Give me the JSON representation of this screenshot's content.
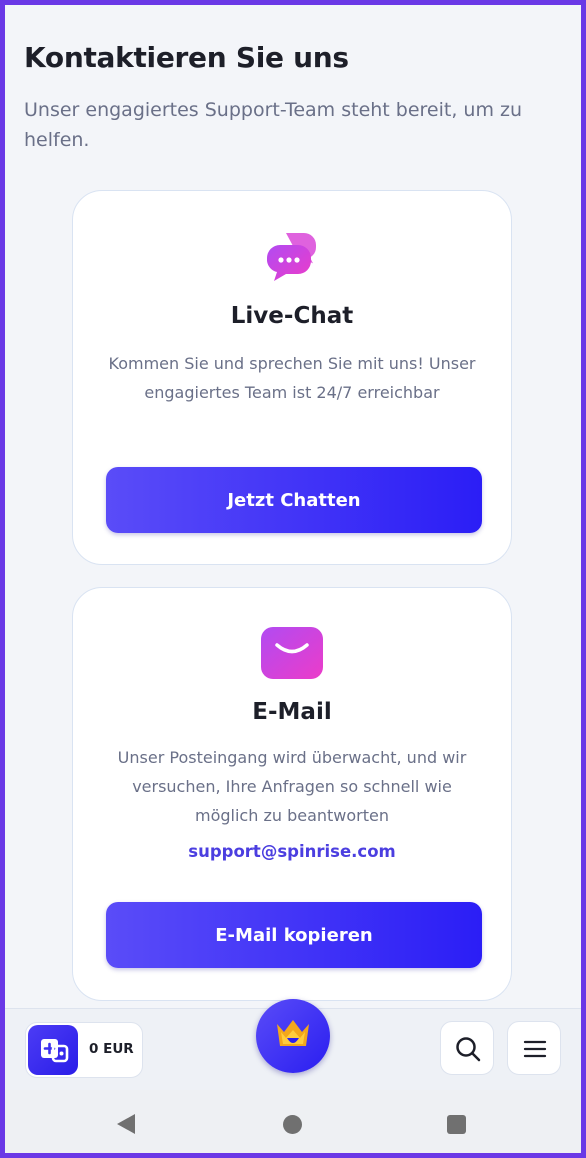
{
  "header": {
    "title": "Kontaktieren Sie uns",
    "subtitle": "Unser engagiertes Support-Team steht bereit, um zu helfen."
  },
  "cards": [
    {
      "icon": "chat-bubbles-icon",
      "title": "Live-Chat",
      "description": "Kommen Sie und sprechen Sie mit uns! Unser engagiertes Team ist 24/7 erreichbar",
      "button_label": "Jetzt Chatten"
    },
    {
      "icon": "mail-icon",
      "title": "E-Mail",
      "description": "Unser Posteingang wird überwacht, und wir versuchen, Ihre Anfragen so schnell wie möglich zu beantworten",
      "email": "support@spinrise.com",
      "button_label": "E-Mail kopieren"
    }
  ],
  "bottom_bar": {
    "wallet_icon": "wallet-add-icon",
    "balance": "0 EUR",
    "logo_icon": "crown-logo-icon",
    "search_icon": "search-icon",
    "menu_icon": "hamburger-menu-icon"
  },
  "system_nav": {
    "back_icon": "back-triangle-icon",
    "home_icon": "home-circle-icon",
    "recents_icon": "recents-square-icon"
  },
  "colors": {
    "accent": "#3b2ff5",
    "frame_border": "#6a38e6",
    "icon_gradient_start": "#b14bf2",
    "icon_gradient_end": "#ec3cc9",
    "email_link": "#4b3ee0"
  }
}
